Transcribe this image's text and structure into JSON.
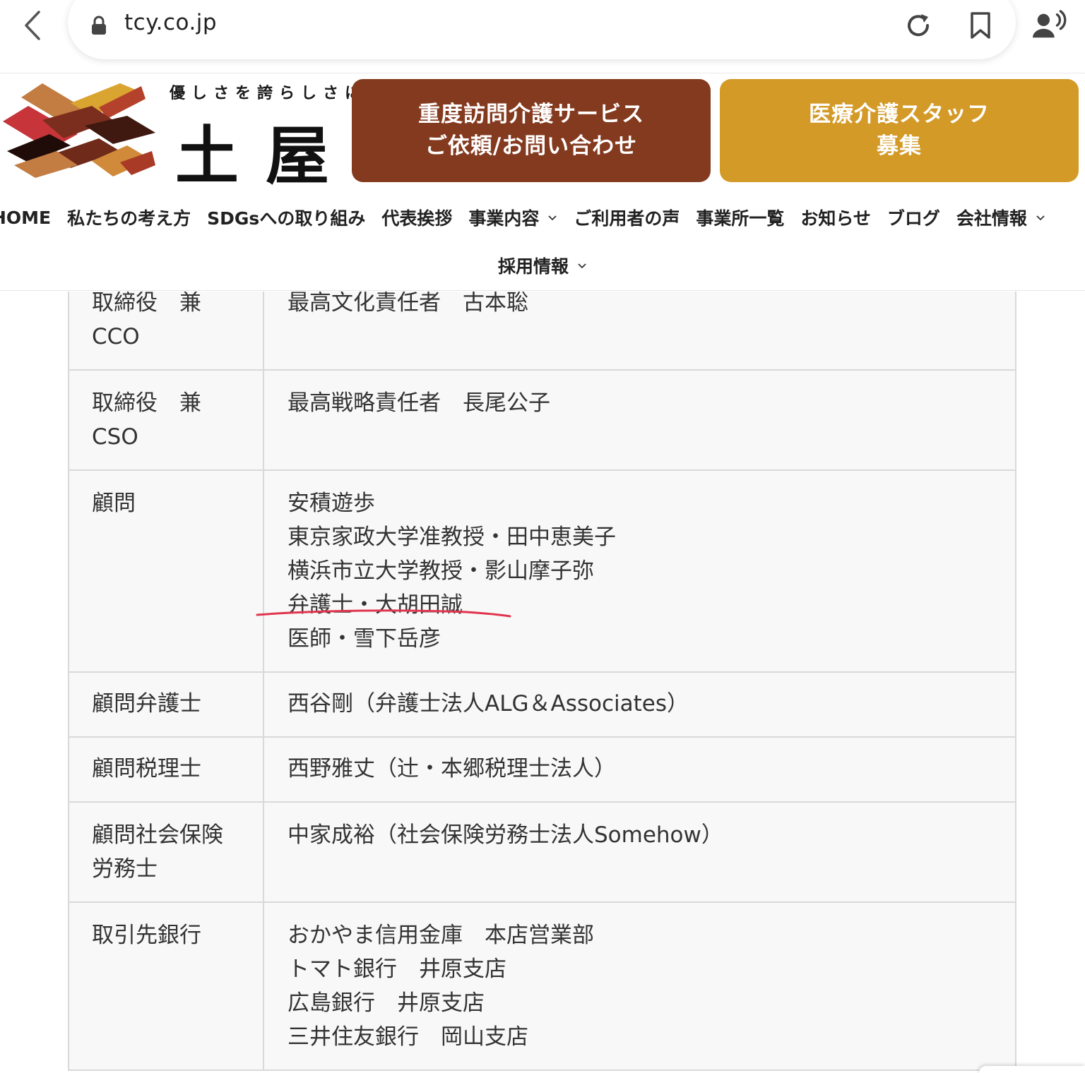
{
  "browser": {
    "url": "tcy.co.jp",
    "icons": [
      "chevron-left-icon",
      "lock-icon",
      "reload-icon",
      "bookmark-icon",
      "person-speaking-icon"
    ]
  },
  "header": {
    "tagline": "優しさを誇らしさに",
    "brand": "土屋",
    "cta_visit": {
      "line1": "重度訪問介護サービス",
      "line2": "ご依頼/お問い合わせ",
      "color": "#843a1f"
    },
    "cta_staff": {
      "line1": "医療介護スタッフ",
      "line2": "募集",
      "color": "#d39a28"
    }
  },
  "nav": {
    "items": [
      {
        "label": "HOME"
      },
      {
        "label": "私たちの考え方"
      },
      {
        "label": "SDGsへの取り組み"
      },
      {
        "label": "代表挨拶"
      },
      {
        "label": "事業内容"
      },
      {
        "label": "ご利用者の声"
      },
      {
        "label": "事業所一覧"
      },
      {
        "label": "お知らせ"
      },
      {
        "label": "ブログ"
      },
      {
        "label": "会社情報"
      }
    ],
    "row2": {
      "label": "採用情報"
    }
  },
  "table": {
    "rows": [
      {
        "label": [
          "取締役　兼",
          "CCO"
        ],
        "value": [
          "最高文化責任者　古本聡"
        ]
      },
      {
        "label": [
          "取締役　兼",
          "CSO"
        ],
        "value": [
          "最高戦略責任者　長尾公子"
        ]
      },
      {
        "label": [
          "顧問"
        ],
        "value": [
          "安積遊歩",
          "東京家政大学准教授・田中恵美子",
          "横浜市立大学教授・影山摩子弥",
          "弁護士・大胡田誠",
          "医師・雪下岳彦"
        ]
      },
      {
        "label": [
          "顧問弁護士"
        ],
        "value": [
          "西谷剛（弁護士法人ALG＆Associates）"
        ]
      },
      {
        "label": [
          "顧問税理士"
        ],
        "value": [
          "西野雅丈（辻・本郷税理士法人）"
        ]
      },
      {
        "label": [
          "顧問社会保険",
          "労務士"
        ],
        "value": [
          "中家成裕（社会保険労務士法人Somehow）"
        ]
      },
      {
        "label": [
          "取引先銀行"
        ],
        "value": [
          "おかやま信用金庫　本店営業部",
          "トマト銀行　井原支店",
          "広島銀行　井原支店",
          "三井住友銀行　岡山支店"
        ]
      }
    ],
    "annotation_color": "#e0354f"
  }
}
